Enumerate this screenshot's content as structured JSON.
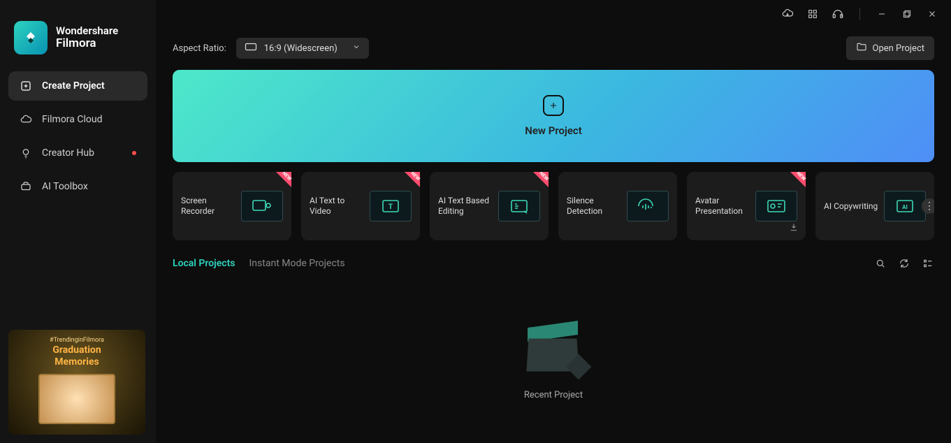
{
  "app": {
    "vendor": "Wondershare",
    "name": "Filmora"
  },
  "sidebar": {
    "items": [
      {
        "label": "Create Project",
        "icon": "plus-square-icon"
      },
      {
        "label": "Filmora Cloud",
        "icon": "cloud-icon"
      },
      {
        "label": "Creator Hub",
        "icon": "bulb-icon"
      },
      {
        "label": "AI Toolbox",
        "icon": "ai-toolbox-icon"
      }
    ]
  },
  "promo": {
    "hashtag": "#TrendinginFilmora",
    "title_line1": "Graduation",
    "title_line2": "Memories"
  },
  "topbar": {
    "aspect_label": "Aspect Ratio:",
    "aspect_value": "16:9 (Widescreen)",
    "open_label": "Open Project"
  },
  "new_project": {
    "label": "New Project"
  },
  "tiles": [
    {
      "label": "Screen Recorder",
      "new": true
    },
    {
      "label": "AI Text to Video",
      "new": true
    },
    {
      "label": "AI Text Based Editing",
      "new": true
    },
    {
      "label": "Silence Detection",
      "new": false
    },
    {
      "label": "Avatar Presentation",
      "new": true,
      "download": true
    },
    {
      "label": "AI Copywriting",
      "new": false
    }
  ],
  "tabs": {
    "items": [
      {
        "label": "Local Projects",
        "active": true
      },
      {
        "label": "Instant Mode Projects",
        "active": false
      }
    ]
  },
  "empty_state": {
    "label": "Recent Project"
  }
}
